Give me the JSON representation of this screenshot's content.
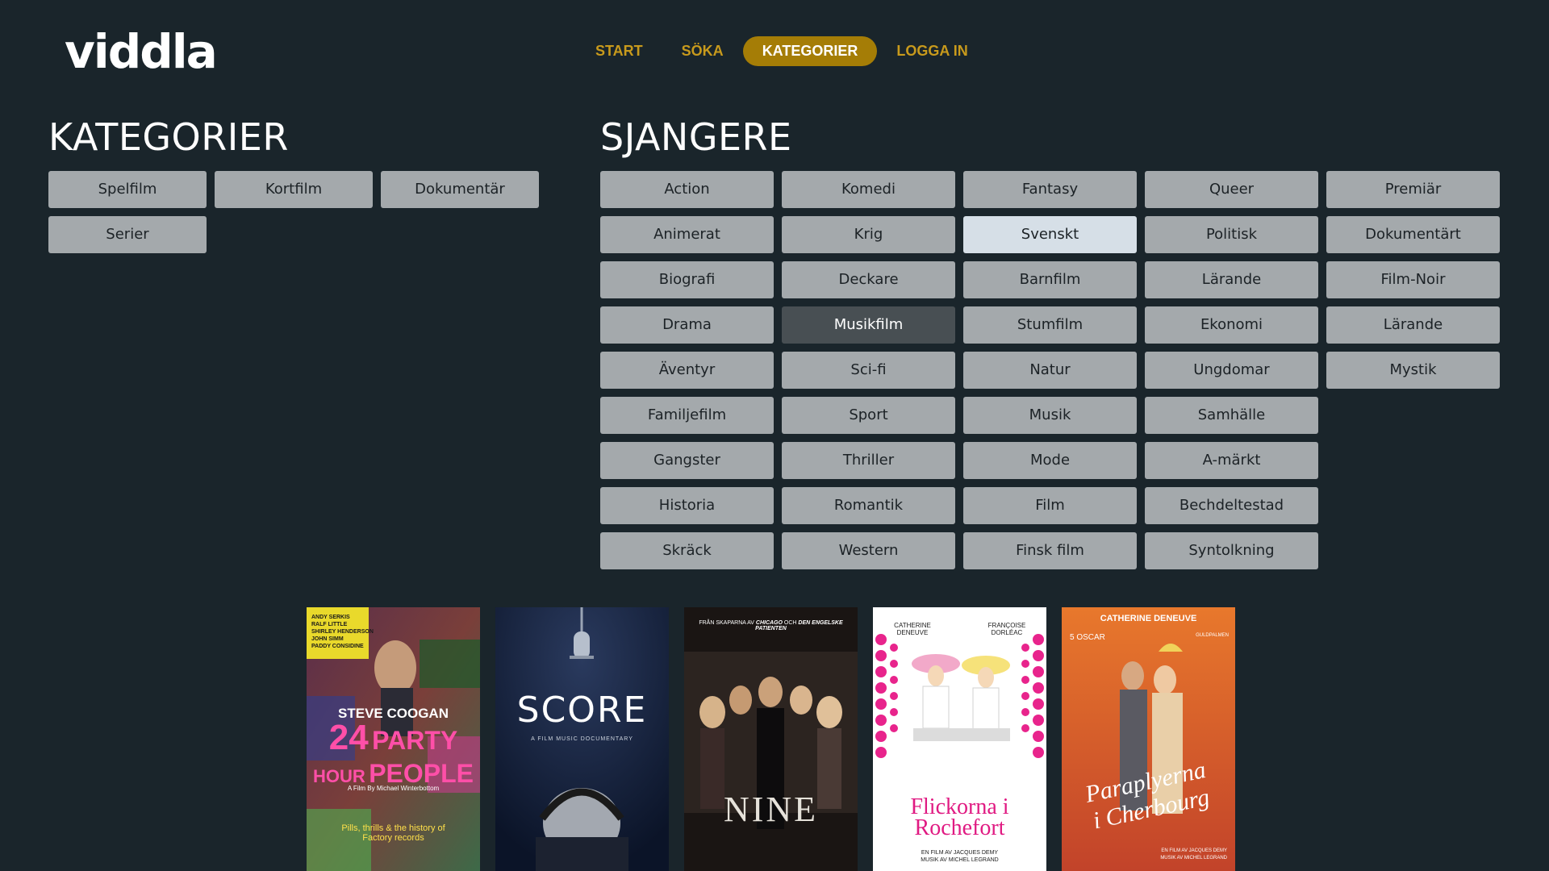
{
  "brand": {
    "logo_text": "viddla"
  },
  "nav": [
    {
      "label": "START",
      "active": false
    },
    {
      "label": "SÖKA",
      "active": false
    },
    {
      "label": "KATEGORIER",
      "active": true
    },
    {
      "label": "LOGGA IN",
      "active": false
    }
  ],
  "kategorier": {
    "title": "KATEGORIER",
    "items": [
      "Spelfilm",
      "Kortfilm",
      "Dokumentär",
      "Serier"
    ]
  },
  "sjangere": {
    "title": "SJANGERE",
    "selected": "Svenskt",
    "hovered": "Musikfilm",
    "items": [
      "Action",
      "Komedi",
      "Fantasy",
      "Queer",
      "Premiär",
      "Animerat",
      "Krig",
      "Svenskt",
      "Politisk",
      "Dokumentärt",
      "Biografi",
      "Deckare",
      "Barnfilm",
      "Lärande",
      "Film-Noir",
      "Drama",
      "Musikfilm",
      "Stumfilm",
      "Ekonomi",
      "Lärande",
      "Äventyr",
      "Sci-fi",
      "Natur",
      "Ungdomar",
      "Mystik",
      "Familjefilm",
      "Sport",
      "Musik",
      "Samhälle",
      "Gangster",
      "Thriller",
      "Mode",
      "A-märkt",
      "Historia",
      "Romantik",
      "Film",
      "Bechdeltestad",
      "Skräck",
      "Western",
      "Finsk film",
      "Syntolkning"
    ]
  },
  "posters": [
    {
      "top_names": [
        "ANDY SERKIS",
        "RALF LITTLE",
        "SHIRLEY HENDERSON",
        "JOHN SIMM",
        "PADDY CONSIDINE"
      ],
      "actor": "STEVE COOGAN",
      "title_a": "24",
      "title_b": "PARTY",
      "title_c": "HOUR",
      "title_d": "PEOPLE",
      "credit": "A Film By Michael Winterbottom",
      "tagline": "Pills, thrills & the history of Factory records"
    },
    {
      "title": "SCORE",
      "subtitle": "A FILM MUSIC DOCUMENTARY"
    },
    {
      "header_a": "FRÅN SKAPARNA AV",
      "header_b": "CHICAGO",
      "header_c": "OCH",
      "header_d": "DEN ENGELSKE PATIENTEN",
      "title": "NINE"
    },
    {
      "actor_left": "CATHERINE DENEUVE",
      "actor_right": "FRANÇOISE DORLÉAC",
      "title_line1": "Flickorna i",
      "title_line2": "Rochefort",
      "credit1": "EN FILM AV JACQUES DEMY",
      "credit2": "MUSIK AV MICHEL LEGRAND"
    },
    {
      "actor": "CATHERINE DENEUVE",
      "award": "5 OSCAR",
      "palme": "GULDPALMEN",
      "title_line1": "Paraplyerna",
      "title_line2": "i Cherbourg",
      "credit1": "EN FILM AV JACQUES DEMY",
      "credit2": "MUSIK AV MICHEL LEGRAND"
    }
  ],
  "colors": {
    "background": "#1a252b",
    "accent": "#a57d06",
    "nav_text": "#c89a1c",
    "tile": "#a4a9ac",
    "tile_selected": "#d6dfe7",
    "tile_hover": "#484f53"
  }
}
